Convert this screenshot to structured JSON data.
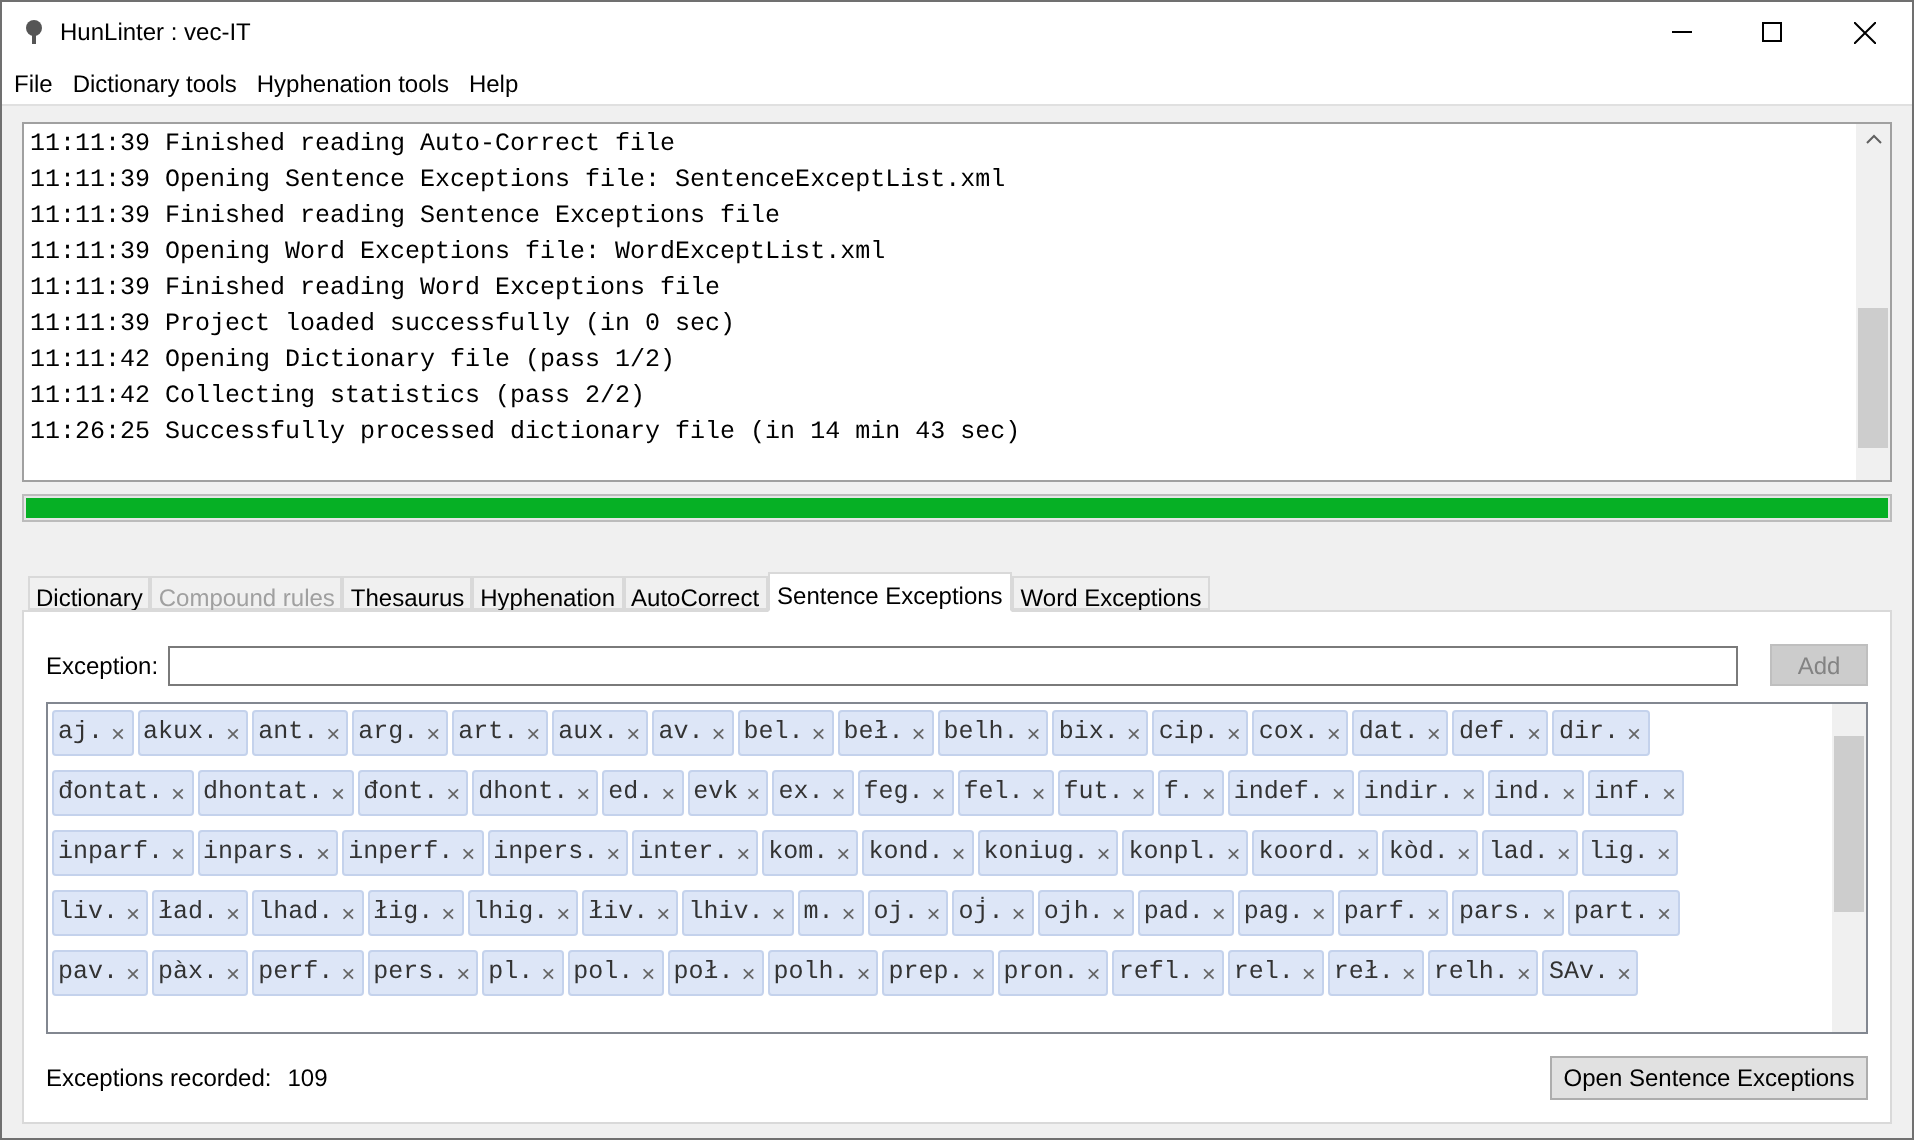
{
  "window": {
    "title": "HunLinter : vec-IT"
  },
  "menu": [
    {
      "label": "File"
    },
    {
      "label": "Dictionary tools"
    },
    {
      "label": "Hyphenation tools"
    },
    {
      "label": "Help"
    }
  ],
  "log": [
    "11:11:39 Finished reading Auto-Correct file",
    "11:11:39 Opening Sentence Exceptions file: SentenceExceptList.xml",
    "11:11:39 Finished reading Sentence Exceptions file",
    "11:11:39 Opening Word Exceptions file: WordExceptList.xml",
    "11:11:39 Finished reading Word Exceptions file",
    "11:11:39 Project loaded successfully (in 0 sec)",
    "11:11:42 Opening Dictionary file (pass 1/2)",
    "11:11:42 Collecting statistics (pass 2/2)",
    "11:26:25 Successfully processed dictionary file (in 14 min 43 sec)"
  ],
  "progress": {
    "level": 1
  },
  "tabs": [
    {
      "label": "Dictionary",
      "selected": false,
      "disabled": false
    },
    {
      "label": "Compound rules",
      "selected": false,
      "disabled": true
    },
    {
      "label": "Thesaurus",
      "selected": false,
      "disabled": false
    },
    {
      "label": "Hyphenation",
      "selected": false,
      "disabled": false
    },
    {
      "label": "AutoCorrect",
      "selected": false,
      "disabled": false
    },
    {
      "label": "Sentence Exceptions",
      "selected": true,
      "disabled": false
    },
    {
      "label": "Word Exceptions",
      "selected": false,
      "disabled": false
    }
  ],
  "exception_field": {
    "label": "Exception:"
  },
  "add_button": {
    "label": "Add",
    "disabled": true
  },
  "exceptions": [
    [
      "aj.",
      "akux.",
      "ant.",
      "arg.",
      "art.",
      "aux.",
      "av.",
      "bel.",
      "beł.",
      "belh.",
      "bix.",
      "cip.",
      "cox.",
      "dat.",
      "def.",
      "dir."
    ],
    [
      "đontat.",
      "dhontat.",
      "đont.",
      "dhont.",
      "ed.",
      "evk",
      "ex.",
      "feg.",
      "fel.",
      "fut.",
      "f.",
      "indef.",
      "indir.",
      "ind.",
      "inf."
    ],
    [
      "inparf.",
      "inpars.",
      "inperf.",
      "inpers.",
      "inter.",
      "kom.",
      "kond.",
      "koniug.",
      "konpl.",
      "koord.",
      "kòd.",
      "lad.",
      "lig."
    ],
    [
      "liv.",
      "ład.",
      "lhad.",
      "łig.",
      "lhig.",
      "łiv.",
      "lhiv.",
      "m.",
      "oj.",
      "oj̇.",
      "ojh.",
      "pad.",
      "pag.",
      "parf.",
      "pars.",
      "part."
    ],
    [
      "pav.",
      "pàx.",
      "perf.",
      "pers.",
      "pl.",
      "pol.",
      "poł.",
      "polh.",
      "prep.",
      "pron.",
      "refl.",
      "rel.",
      "reł.",
      "relh.",
      "SAv."
    ]
  ],
  "remove_glyph": "×",
  "footer": {
    "label": "Exceptions recorded:",
    "count": "109"
  },
  "open_button": {
    "label": "Open Sentence Exceptions"
  }
}
